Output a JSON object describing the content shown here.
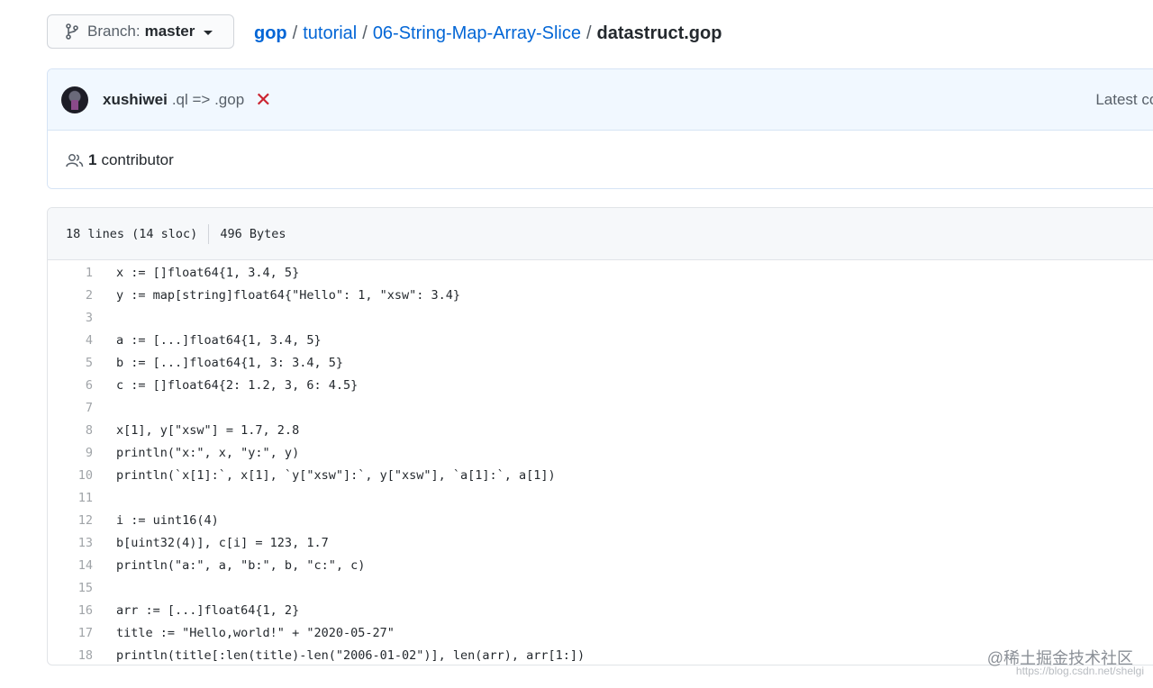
{
  "branch": {
    "prefix": "Branch:",
    "name": "master"
  },
  "breadcrumb": {
    "items": [
      "gop",
      "tutorial",
      "06-String-Map-Array-Slice"
    ],
    "separator": "/",
    "current": "datastruct.gop"
  },
  "commit": {
    "author": "xushiwei",
    "message": ".ql => .gop",
    "status_icon": "✕",
    "latest_label": "Latest cor"
  },
  "contributors": {
    "count": "1",
    "label": "contributor"
  },
  "file": {
    "lines_info": "18 lines (14 sloc)",
    "size": "496 Bytes",
    "lines": [
      {
        "n": "1",
        "code": "x := []float64{1, 3.4, 5}"
      },
      {
        "n": "2",
        "code": "y := map[string]float64{\"Hello\": 1, \"xsw\": 3.4}"
      },
      {
        "n": "3",
        "code": ""
      },
      {
        "n": "4",
        "code": "a := [...]float64{1, 3.4, 5}"
      },
      {
        "n": "5",
        "code": "b := [...]float64{1, 3: 3.4, 5}"
      },
      {
        "n": "6",
        "code": "c := []float64{2: 1.2, 3, 6: 4.5}"
      },
      {
        "n": "7",
        "code": ""
      },
      {
        "n": "8",
        "code": "x[1], y[\"xsw\"] = 1.7, 2.8"
      },
      {
        "n": "9",
        "code": "println(\"x:\", x, \"y:\", y)"
      },
      {
        "n": "10",
        "code": "println(`x[1]:`, x[1], `y[\"xsw\"]:`, y[\"xsw\"], `a[1]:`, a[1])"
      },
      {
        "n": "11",
        "code": ""
      },
      {
        "n": "12",
        "code": "i := uint16(4)"
      },
      {
        "n": "13",
        "code": "b[uint32(4)], c[i] = 123, 1.7"
      },
      {
        "n": "14",
        "code": "println(\"a:\", a, \"b:\", b, \"c:\", c)"
      },
      {
        "n": "15",
        "code": ""
      },
      {
        "n": "16",
        "code": "arr := [...]float64{1, 2}"
      },
      {
        "n": "17",
        "code": "title := \"Hello,world!\" + \"2020-05-27\""
      },
      {
        "n": "18",
        "code": "println(title[:len(title)-len(\"2006-01-02\")], len(arr), arr[1:])"
      }
    ]
  },
  "watermark": {
    "text": "@稀土掘金技术社区",
    "url": "https://blog.csdn.net/shelgi"
  },
  "colors": {
    "link": "#0366d6",
    "error": "#cb2431",
    "commit_bg": "#f1f8ff"
  }
}
